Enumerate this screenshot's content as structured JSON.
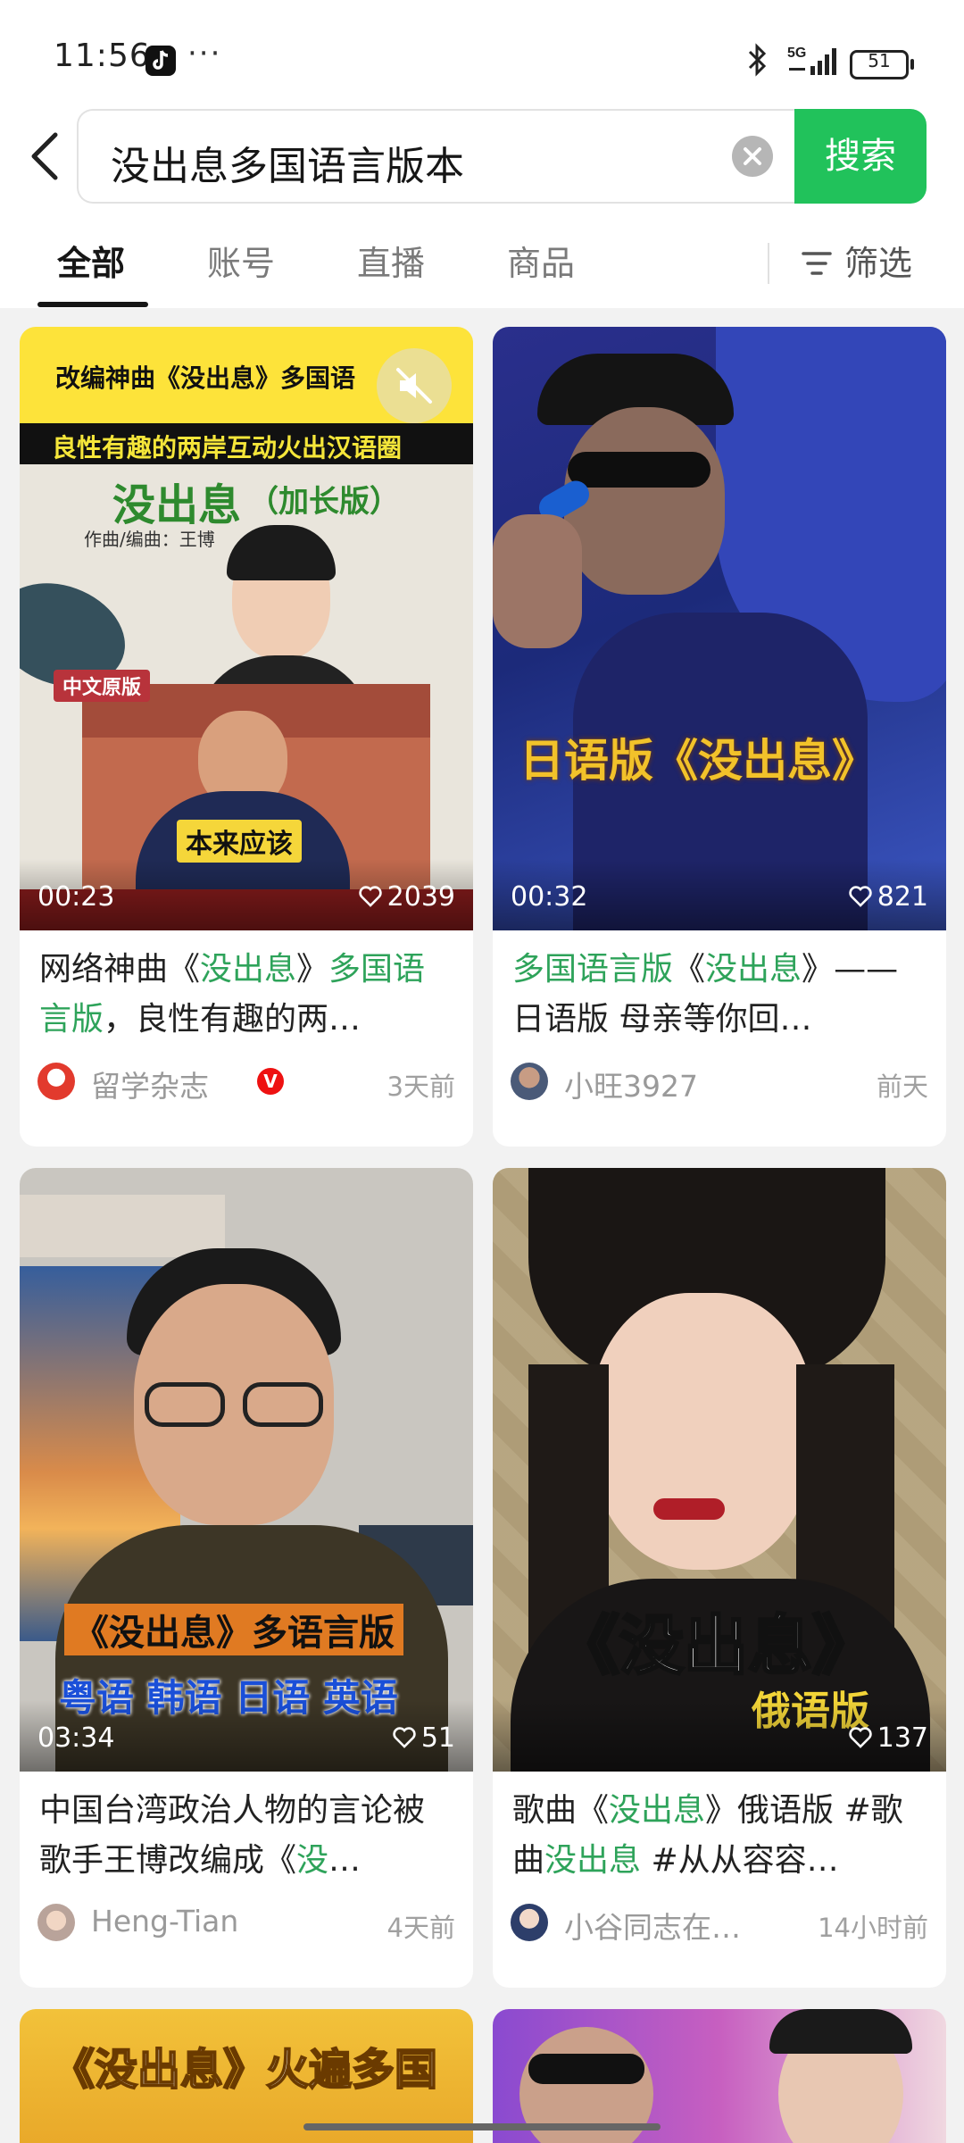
{
  "status": {
    "time": "11:56",
    "dots": "···",
    "network": "5G",
    "battery": "51"
  },
  "search": {
    "query": "没出息多国语言版本",
    "button": "搜索"
  },
  "tabs": [
    "全部",
    "账号",
    "直播",
    "商品"
  ],
  "filter_label": "筛选",
  "cards": [
    {
      "duration": "00:23",
      "likes": "2039",
      "title_parts": [
        "网络神曲《",
        "没出息",
        "》",
        "多国语言版",
        "，良性有趣的两…"
      ],
      "author": "留学杂志",
      "time": "3天前",
      "overlay": {
        "top_header": "改编神曲《没出息》多国语",
        "subheader": "良性有趣的两岸互动火出汉语圈",
        "song_title": "没出息",
        "song_suffix": "（加长版）",
        "credit": "作曲/编曲：王博",
        "tag": "中文原版",
        "caption": "本来应该"
      }
    },
    {
      "duration": "00:32",
      "likes": "821",
      "title_parts": [
        "多国语言版",
        "《",
        "没出息",
        "》",
        "——日语版 母亲等你回…"
      ],
      "author": "小旺3927",
      "time": "前天",
      "overlay": {
        "caption": "日语版《没出息》"
      }
    },
    {
      "duration": "03:34",
      "likes": "51",
      "title_parts": [
        "中国台湾政治人物的言论被歌手王博改编成《",
        "没",
        "…"
      ],
      "author": "Heng-Tian",
      "time": "4天前",
      "overlay": {
        "line1": "《没出息》多语言版",
        "line2": "粤语 韩语 日语 英语"
      }
    },
    {
      "duration": "",
      "likes": "137",
      "title_parts": [
        "歌曲《",
        "没出息",
        "》俄语版 #歌曲",
        "没出息",
        " #从从容容…"
      ],
      "author": "小谷同志在…",
      "time": "14小时前",
      "overlay": {
        "big": "《没出息》",
        "small": "俄语版"
      }
    }
  ],
  "partial_cards": [
    {
      "overlay": "《没出息》火遍多国"
    }
  ],
  "colors": {
    "accent_green": "#21c25b",
    "link_green": "#2ea35a"
  }
}
